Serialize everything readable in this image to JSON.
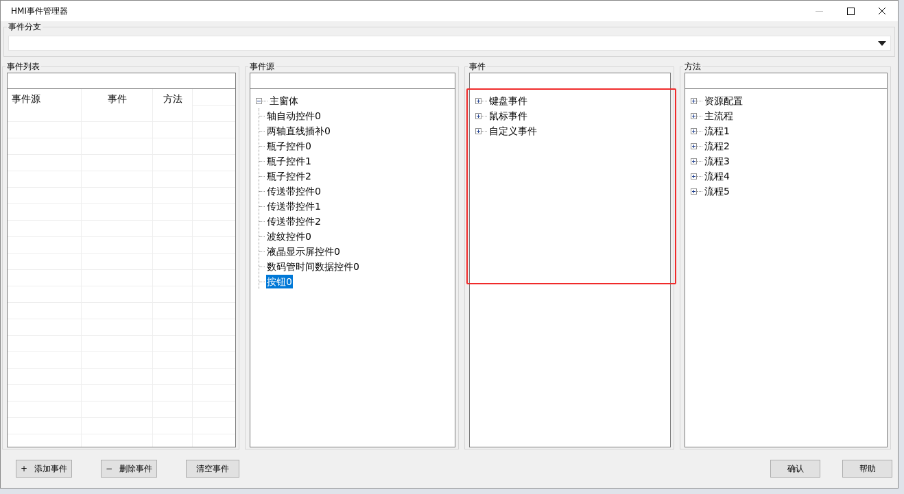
{
  "window": {
    "title": "HMI事件管理器"
  },
  "branch": {
    "label": "事件分支"
  },
  "event_list": {
    "label": "事件列表",
    "columns": [
      "事件源",
      "事件",
      "方法"
    ]
  },
  "event_source": {
    "label": "事件源",
    "tree": [
      {
        "label": "主窗体",
        "expanded": true,
        "selected": false,
        "children": [
          {
            "label": "轴自动控件0",
            "selected": false
          },
          {
            "label": "两轴直线插补0",
            "selected": false
          },
          {
            "label": "瓶子控件0",
            "selected": false
          },
          {
            "label": "瓶子控件1",
            "selected": false
          },
          {
            "label": "瓶子控件2",
            "selected": false
          },
          {
            "label": "传送带控件0",
            "selected": false
          },
          {
            "label": "传送带控件1",
            "selected": false
          },
          {
            "label": "传送带控件2",
            "selected": false
          },
          {
            "label": "波纹控件0",
            "selected": false
          },
          {
            "label": "液晶显示屏控件0",
            "selected": false
          },
          {
            "label": "数码管时间数据控件0",
            "selected": false
          },
          {
            "label": "按钮0",
            "selected": true
          }
        ]
      }
    ]
  },
  "events": {
    "label": "事件",
    "highlighted": true,
    "tree": [
      {
        "label": "键盘事件",
        "expanded": false,
        "selected": false
      },
      {
        "label": "鼠标事件",
        "expanded": false,
        "selected": false
      },
      {
        "label": "自定义事件",
        "expanded": false,
        "selected": false
      }
    ]
  },
  "methods": {
    "label": "方法",
    "tree": [
      {
        "label": "资源配置",
        "expanded": false,
        "selected": false
      },
      {
        "label": "主流程",
        "expanded": false,
        "selected": false
      },
      {
        "label": "流程1",
        "expanded": false,
        "selected": false
      },
      {
        "label": "流程2",
        "expanded": false,
        "selected": false
      },
      {
        "label": "流程3",
        "expanded": false,
        "selected": false
      },
      {
        "label": "流程4",
        "expanded": false,
        "selected": false
      },
      {
        "label": "流程5",
        "expanded": false,
        "selected": false
      }
    ]
  },
  "left_buttons": [
    {
      "icon": "+",
      "label": "添加事件"
    },
    {
      "icon": "−",
      "label": "删除事件"
    },
    {
      "label": "清空事件"
    }
  ],
  "right_buttons": [
    {
      "label": "确认"
    },
    {
      "label": "帮助"
    }
  ]
}
